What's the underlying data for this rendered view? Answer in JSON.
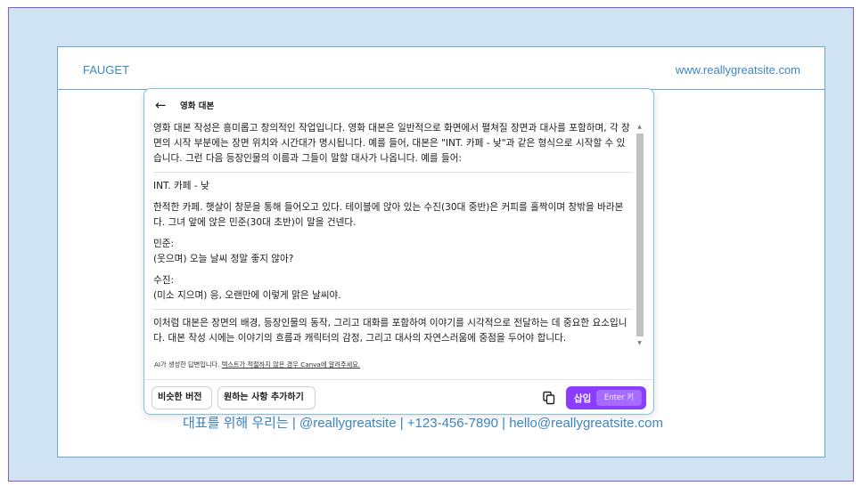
{
  "document": {
    "brand": "FAUGET",
    "website": "www.reallygreatsite.com",
    "footer_partial": "대표를 위해 우리는 | @reallygreatsite | +123-456-7890 | hello@reallygreatsite.com"
  },
  "panel": {
    "title": "영화 대본",
    "paragraph1": "영화 대본 작성은 흥미롭고 창의적인 작업입니다. 영화 대본은 일반적으로 화면에서 펼쳐질 장면과 대사를 포함하며, 각 장면의 시작 부분에는 장면 위치와 시간대가 명시됩니다. 예를 들어, 대본은 \"INT. 카페 - 낮\"과 같은 형식으로 시작할 수 있습니다. 그런 다음 등장인물의 이름과 그들이 말할 대사가 나옵니다. 예를 들어:",
    "scene_heading": "INT. 카페 - 낮",
    "action": "한적한 카페. 햇살이 창문을 통해 들어오고 있다. 테이블에 앉아 있는 수진(30대 중반)은 커피를 홀짝이며 창밖을 바라본다. 그녀 앞에 앉은 민준(30대 초반)이 말을 건넨다.",
    "character1": "민준:",
    "line1": "(웃으며) 오늘 날씨 정말 좋지 않아?",
    "character2": "수진:",
    "line2": "(미소 지으며) 응, 오랜만에 이렇게 맑은 날씨야.",
    "paragraph_end": "이처럼 대본은 장면의 배경, 등장인물의 동작, 그리고 대화를 포함하여 이야기를 시각적으로 전달하는 데 중요한 요소입니다. 대본 작성 시에는 이야기의 흐름과 캐릭터의 감정, 그리고 대사의 자연스러움에 중점을 두어야 합니다.",
    "disclaimer_text": "AI가 생성한 답변입니다. ",
    "disclaimer_link": "텍스트가 적절하지 않은 경우 Canva에 알려주세요.",
    "similar_button": "비슷한 버전",
    "add_request_button": "원하는 사항 추가하기",
    "insert_label": "삽입",
    "enter_hint": "Enter 키"
  },
  "colors": {
    "accent": "#8b3dff",
    "background": "#cfe3f2",
    "frame": "#8c53e8",
    "brand_blue": "#3e86c5"
  },
  "icons": [
    "back-arrow-icon",
    "copy-icon",
    "scroll-up-icon",
    "scroll-down-icon"
  ]
}
